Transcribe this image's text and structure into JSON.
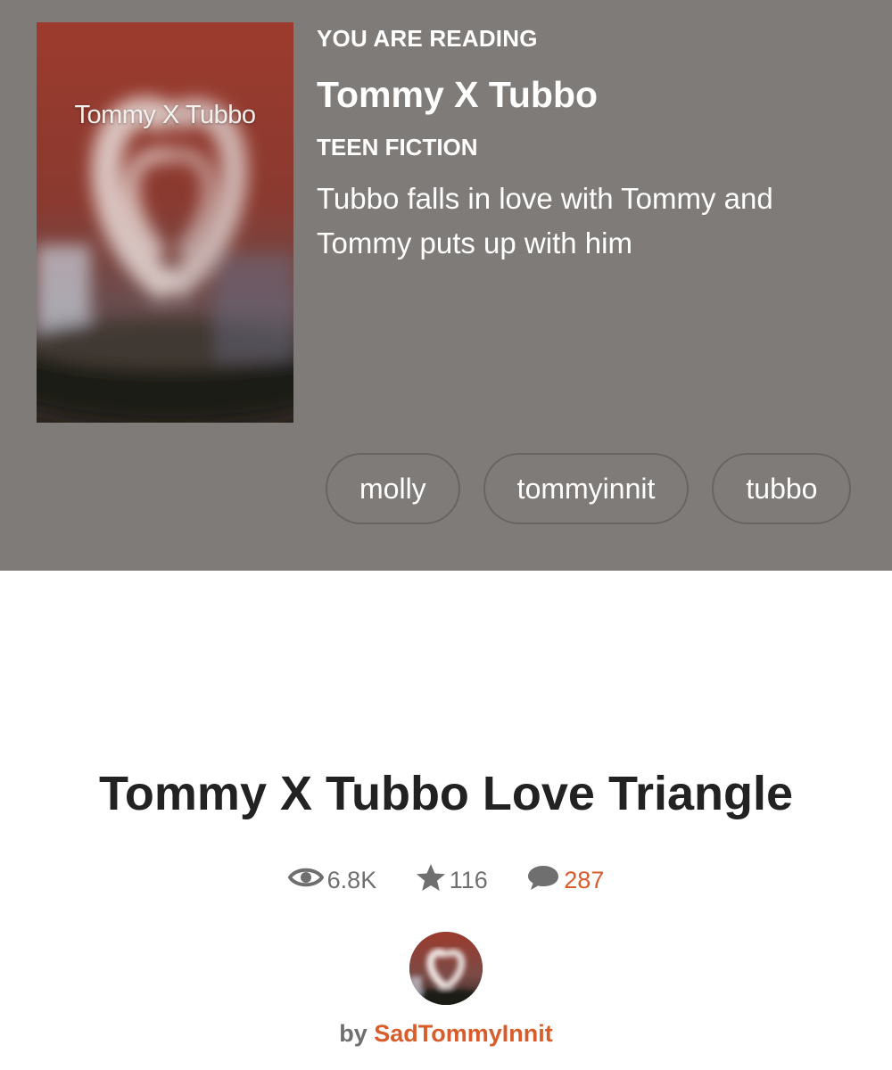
{
  "header": {
    "eyebrow": "YOU ARE READING",
    "story_title": "Tommy X Tubbo",
    "category": "TEEN FICTION",
    "description": "Tubbo falls in love with Tommy and Tommy puts up with him",
    "cover_text": "Tommy X Tubbo",
    "background_color": "#7f7b78",
    "tags": [
      "molly",
      "tommyinnit",
      "tubbo"
    ]
  },
  "part": {
    "title": "Tommy X Tubbo Love Triangle",
    "stats": {
      "reads": "6.8K",
      "votes": "116",
      "comments": "287"
    },
    "byline": {
      "prefix": "by",
      "author": "SadTommyInnit"
    }
  },
  "icons": {
    "reads": "eye-icon",
    "votes": "star-icon",
    "comments": "comment-bubble-icon"
  },
  "colors": {
    "accent": "#d95c2b",
    "muted_text": "#6f6f6f",
    "title_text": "#222222"
  }
}
